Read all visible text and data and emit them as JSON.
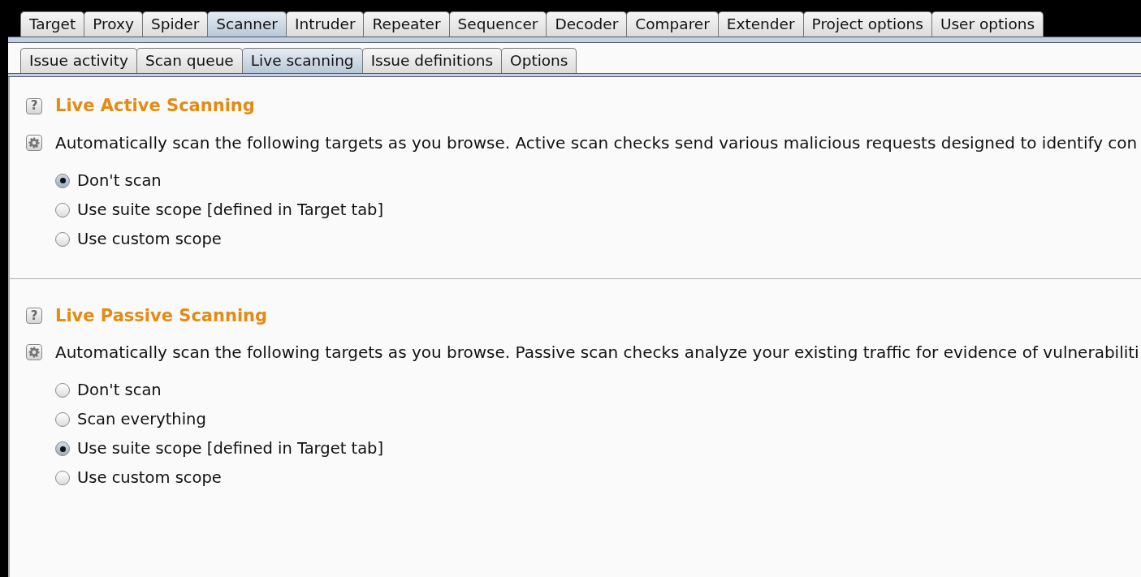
{
  "main_tabs": [
    {
      "label": "Target",
      "selected": false
    },
    {
      "label": "Proxy",
      "selected": false
    },
    {
      "label": "Spider",
      "selected": false
    },
    {
      "label": "Scanner",
      "selected": true
    },
    {
      "label": "Intruder",
      "selected": false
    },
    {
      "label": "Repeater",
      "selected": false
    },
    {
      "label": "Sequencer",
      "selected": false
    },
    {
      "label": "Decoder",
      "selected": false
    },
    {
      "label": "Comparer",
      "selected": false
    },
    {
      "label": "Extender",
      "selected": false
    },
    {
      "label": "Project options",
      "selected": false
    },
    {
      "label": "User options",
      "selected": false
    }
  ],
  "sub_tabs": [
    {
      "label": "Issue activity",
      "selected": false
    },
    {
      "label": "Scan queue",
      "selected": false
    },
    {
      "label": "Live scanning",
      "selected": true
    },
    {
      "label": "Issue definitions",
      "selected": false
    },
    {
      "label": "Options",
      "selected": false
    }
  ],
  "sections": [
    {
      "title": "Live Active Scanning",
      "help": "?",
      "description": "Automatically scan the following targets as you browse. Active scan checks send various malicious requests designed to identify con",
      "options": [
        {
          "label": "Don't scan",
          "selected": true
        },
        {
          "label": "Use suite scope [defined in Target tab]",
          "selected": false
        },
        {
          "label": "Use custom scope",
          "selected": false
        }
      ]
    },
    {
      "title": "Live Passive Scanning",
      "help": "?",
      "description": "Automatically scan the following targets as you browse. Passive scan checks analyze your existing traffic for evidence of vulnerabiliti",
      "options": [
        {
          "label": "Don't scan",
          "selected": false
        },
        {
          "label": "Scan everything",
          "selected": false
        },
        {
          "label": "Use suite scope [defined in Target tab]",
          "selected": true
        },
        {
          "label": "Use custom scope",
          "selected": false
        }
      ]
    }
  ]
}
